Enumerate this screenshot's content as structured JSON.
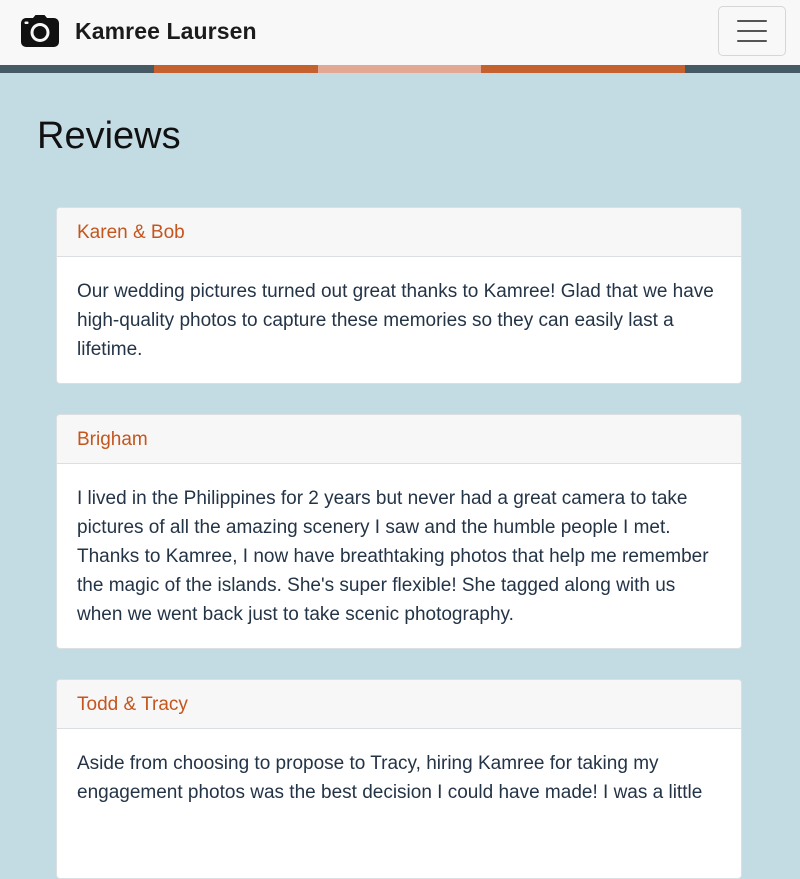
{
  "navbar": {
    "brand_name": "Kamree Laursen",
    "brand_icon": "camera-icon",
    "menu_icon": "hamburger-menu-icon"
  },
  "stripe_colors": [
    "#455a64",
    "#c4612f",
    "#e2a894",
    "#c4612f",
    "#455a64"
  ],
  "page": {
    "title": "Reviews"
  },
  "reviews": [
    {
      "name": "Karen & Bob",
      "text": "Our wedding pictures turned out great thanks to Kamree! Glad that we have high-quality photos to capture these memories so they can easily last a lifetime."
    },
    {
      "name": "Brigham",
      "text": "I lived in the Philippines for 2 years but never had a great camera to take pictures of all the amazing scenery I saw and the humble people I met. Thanks to Kamree, I now have breathtaking photos that help me remember the magic of the islands. She's super flexible! She tagged along with us when we went back just to take scenic photography."
    },
    {
      "name": "Todd & Tracy",
      "text": "Aside from choosing to propose to Tracy, hiring Kamree for taking my engagement photos was the best decision I could have made! I was a little"
    }
  ],
  "colors": {
    "background": "#c3dce3",
    "accent": "#c4551d",
    "body_text": "#243447"
  }
}
